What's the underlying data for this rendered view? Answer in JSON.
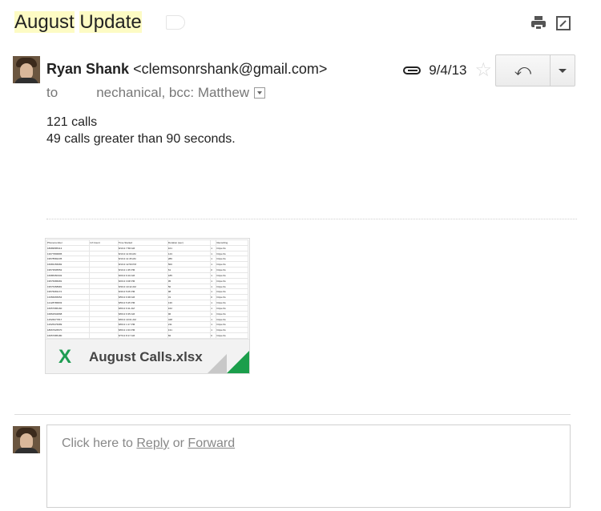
{
  "subject": {
    "word1": "August",
    "word2": "Update"
  },
  "message": {
    "sender_name": "Ryan Shank",
    "sender_email": "<clemsonrshank@gmail.com>",
    "to_prefix": "to",
    "to_rest": "nechanical, bcc: Matthew",
    "date": "9/4/13",
    "body_lines": [
      "121 calls",
      "49 calls greater than 90 seconds."
    ]
  },
  "attachment": {
    "filename": "August Calls.xlsx",
    "type_icon": "X",
    "preview_headers": [
      "Phonenumber",
      "Inf Count",
      "Time Started",
      "Duration (sec)",
      "",
      "Recording"
    ],
    "preview_rows": [
      [
        "18689585313",
        "",
        "8/1/13 7:58 AM",
        "101",
        "1",
        "https://w"
      ],
      [
        "13677806805",
        "",
        "8/1/13 11:09 AM",
        "143",
        "1",
        "https://w"
      ],
      [
        "19578582235",
        "",
        "8/1/13 11:45 AM",
        "286",
        "1",
        "https://w"
      ],
      [
        "16683156082",
        "",
        "8/1/13 12:59 PM",
        "500",
        "1",
        "https://w"
      ],
      [
        "19573505552",
        "",
        "8/1/13 1:35 PM",
        "61",
        "0",
        "https://w"
      ],
      [
        "16686350332",
        "",
        "8/2/13 9:10 AM",
        "185",
        "1",
        "https://w"
      ],
      [
        "19576686081",
        "",
        "8/2/13 3:08 PM",
        "95",
        "1",
        "https://w"
      ],
      [
        "19576358981",
        "",
        "8/3/13 10:42 AM",
        "50",
        "1",
        "https://w"
      ],
      [
        "19576081172",
        "",
        "8/4/13 5:05 PM",
        "98",
        "1",
        "https://w"
      ],
      [
        "13356665654",
        "",
        "8/5/13 9:38 AM",
        "31",
        "0",
        "https://w"
      ],
      [
        "12128786833",
        "",
        "8/5/13 5:25 PM",
        "136",
        "1",
        "https://w"
      ],
      [
        "16657686160",
        "",
        "8/6/13 9:11 AM",
        "162",
        "1",
        "https://w"
      ],
      [
        "16862504898",
        "",
        "8/6/13 6:35 AM",
        "96",
        "1",
        "https://w"
      ],
      [
        "12526077817",
        "",
        "8/6/13 10:01 AM",
        "448",
        "1",
        "https://w"
      ],
      [
        "12525376689",
        "",
        "8/6/13 1:17 PM",
        "211",
        "1",
        "https://w"
      ],
      [
        "18667626570",
        "",
        "8/6/13 4:33 PM",
        "131",
        "1",
        "https://w"
      ],
      [
        "16657685180",
        "",
        "8/7/13 8:17 AM",
        "82",
        "0",
        "https://w"
      ]
    ]
  },
  "reply": {
    "prefix": "Click here to",
    "reply_link": "Reply",
    "or_text": "or",
    "forward_link": "Forward"
  },
  "icons": {
    "print": "print-icon",
    "popout": "new-window-icon",
    "attachment": "paperclip-icon",
    "star": "star-icon",
    "reply": "reply-arrow-icon",
    "more": "chevron-down-icon"
  },
  "colors": {
    "subject_highlight": "#fdfbc4",
    "excel_green": "#1b9e4b",
    "link_gray": "#888888"
  }
}
